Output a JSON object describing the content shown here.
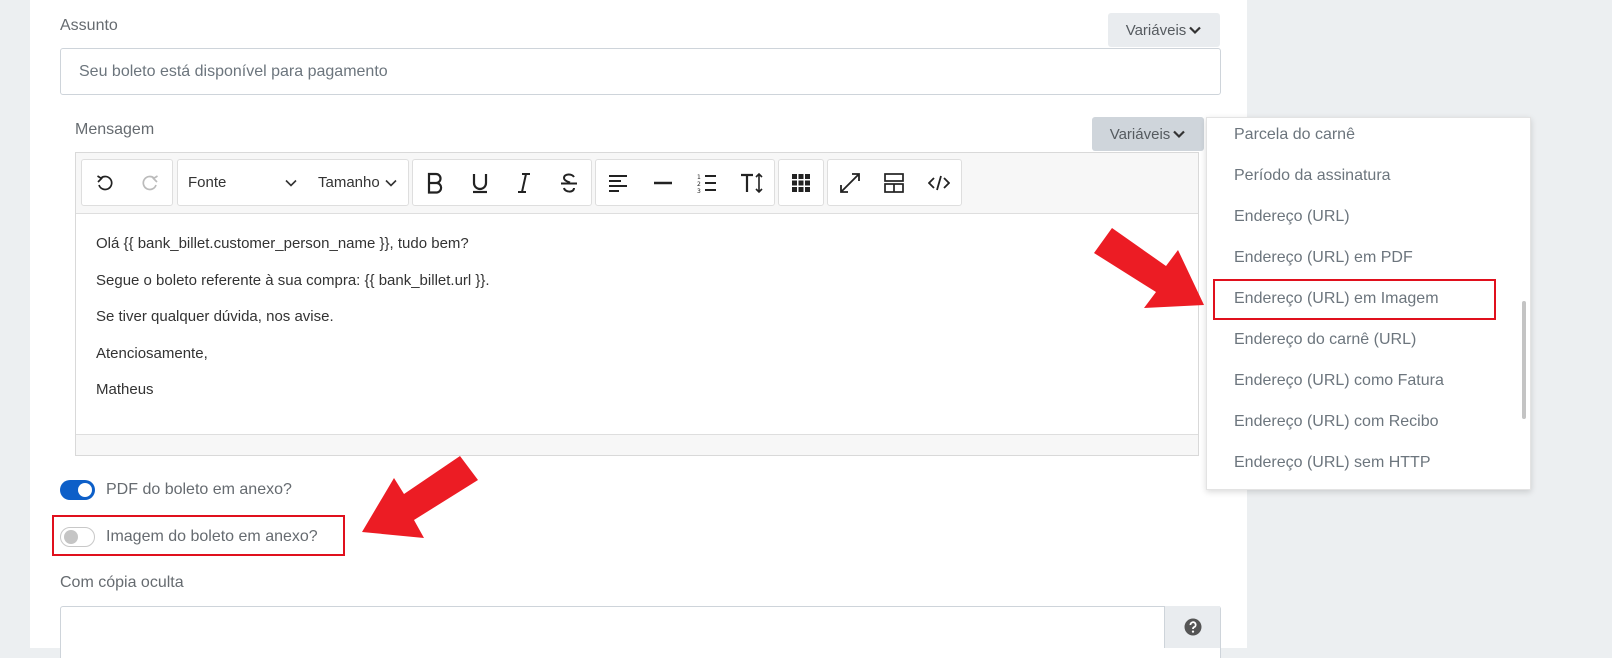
{
  "subject": {
    "label": "Assunto",
    "variables_label": "Variáveis",
    "value": "Seu boleto está disponível para pagamento"
  },
  "message": {
    "label": "Mensagem",
    "variables_label": "Variáveis",
    "toolbar": {
      "font_label": "Fonte",
      "size_label": "Tamanho"
    },
    "lines": [
      "Olá {{ bank_billet.customer_person_name }}, tudo bem?",
      "Segue o boleto referente à sua compra: {{ bank_billet.url }}.",
      "Se tiver qualquer dúvida, nos avise.",
      "Atenciosamente,",
      "Matheus"
    ]
  },
  "options": {
    "pdf_attachment": {
      "label": "PDF do boleto em anexo?",
      "checked": true
    },
    "image_attachment": {
      "label": "Imagem do boleto em anexo?",
      "checked": false
    }
  },
  "bcc": {
    "label": "Com cópia oculta",
    "value": ""
  },
  "variables_dropdown": {
    "items": [
      "Parcela do carnê",
      "Período da assinatura",
      "Endereço (URL)",
      "Endereço (URL) em PDF",
      "Endereço (URL) em Imagem",
      "Endereço do carnê (URL)",
      "Endereço (URL) como Fatura",
      "Endereço (URL) com Recibo",
      "Endereço (URL) sem HTTP"
    ],
    "highlighted_index": 4
  },
  "icons": {
    "undo": "undo-icon",
    "redo": "redo-icon",
    "bold": "bold-icon",
    "underline": "underline-icon",
    "italic": "italic-icon",
    "strikethrough": "strikethrough-icon",
    "align": "align-left-icon",
    "hr": "horizontal-rule-icon",
    "ordered_list": "ordered-list-icon",
    "text_size": "text-height-icon",
    "table": "table-icon",
    "fullscreen": "fullscreen-icon",
    "layout": "layout-icon",
    "code": "code-view-icon",
    "help": "question-circle-icon"
  },
  "colors": {
    "accent": "#0d5fc8",
    "annotation_red": "#e0101d"
  }
}
